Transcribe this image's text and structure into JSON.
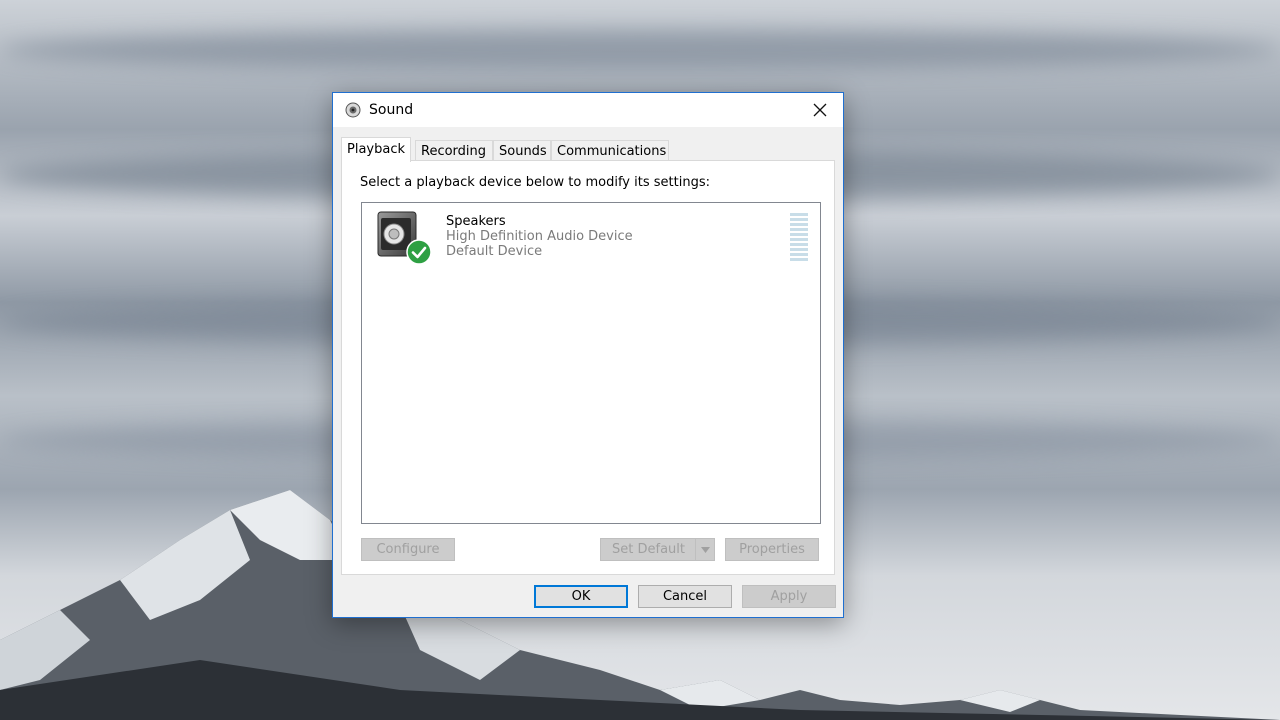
{
  "dialog": {
    "title": "Sound",
    "tabs": [
      {
        "label": "Playback",
        "active": true
      },
      {
        "label": "Recording",
        "active": false
      },
      {
        "label": "Sounds",
        "active": false
      },
      {
        "label": "Communications",
        "active": false
      }
    ],
    "instruction": "Select a playback device below to modify its settings:",
    "devices": [
      {
        "name": "Speakers",
        "description": "High Definition Audio Device",
        "status": "Default Device",
        "icon": "speaker-icon",
        "badge": "default-check-icon"
      }
    ],
    "panel_buttons": {
      "configure": "Configure",
      "set_default": "Set Default",
      "properties": "Properties"
    },
    "footer_buttons": {
      "ok": "OK",
      "cancel": "Cancel",
      "apply": "Apply"
    }
  },
  "colors": {
    "accent": "#0078d7",
    "check_badge": "#2ea043",
    "disabled_text": "#a0a0a0",
    "meter": "#c8dde8"
  }
}
